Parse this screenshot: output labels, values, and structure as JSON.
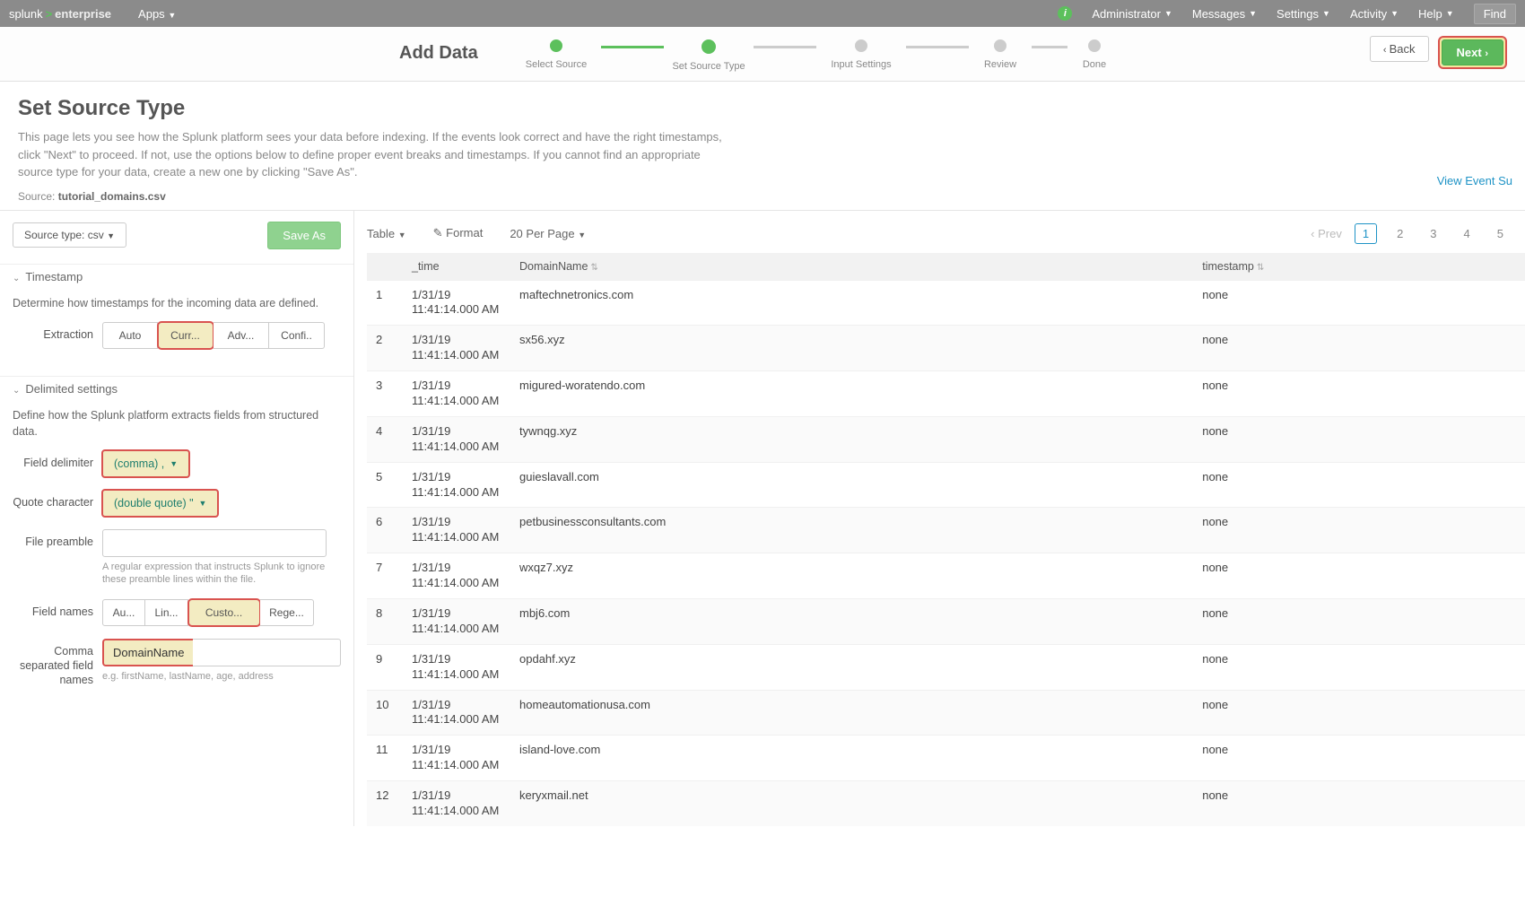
{
  "topbar": {
    "brand_left": "splunk",
    "brand_right": "enterprise",
    "apps": "Apps",
    "menus": [
      "Administrator",
      "Messages",
      "Settings",
      "Activity",
      "Help"
    ],
    "find": "Find"
  },
  "wizard": {
    "title": "Add Data",
    "steps": [
      "Select Source",
      "Set Source Type",
      "Input Settings",
      "Review",
      "Done"
    ],
    "back": "Back",
    "next": "Next"
  },
  "page": {
    "title": "Set Source Type",
    "desc": "This page lets you see how the Splunk platform sees your data before indexing. If the events look correct and have the right timestamps, click \"Next\" to proceed. If not, use the options below to define proper event breaks and timestamps. If you cannot find an appropriate source type for your data, create a new one by clicking \"Save As\".",
    "source_lbl": "Source:",
    "source_val": "tutorial_domains.csv",
    "view_event": "View Event Su"
  },
  "left": {
    "sourcetype": "Source type: csv",
    "saveas": "Save As",
    "ts_header": "Timestamp",
    "ts_desc": "Determine how timestamps for the incoming data are defined.",
    "ts_label": "Extraction",
    "ts_opts": [
      "Auto",
      "Curr...",
      "Adv...",
      "Confi.."
    ],
    "dl_header": "Delimited settings",
    "dl_desc": "Define how the Splunk platform extracts fields from structured data.",
    "fd_label": "Field delimiter",
    "fd_val": "(comma) ,",
    "qc_label": "Quote character",
    "qc_val": "(double quote) \"",
    "fp_label": "File preamble",
    "fp_hint": "A regular expression that instructs Splunk to ignore these preamble lines within the file.",
    "fn_label": "Field names",
    "fn_opts": [
      "Au...",
      "Lin...",
      "Custo...",
      "Rege..."
    ],
    "csfn_label": "Comma separated field names",
    "csfn_val": "DomainName",
    "csfn_hint": "e.g. firstName, lastName, age, address"
  },
  "table": {
    "toolbar": {
      "table": "Table",
      "format": "Format",
      "perpage": "20 Per Page",
      "prev": "Prev"
    },
    "pages": [
      "1",
      "2",
      "3",
      "4",
      "5"
    ],
    "cols": {
      "time": "_time",
      "domain": "DomainName",
      "ts": "timestamp"
    },
    "time_l1": "1/31/19",
    "time_l2": "11:41:14.000 AM",
    "tsval": "none",
    "rows": [
      "maftechnetronics.com",
      "sx56.xyz",
      "migured-woratendo.com",
      "tywnqg.xyz",
      "guieslavall.com",
      "petbusinessconsultants.com",
      "wxqz7.xyz",
      "mbj6.com",
      "opdahf.xyz",
      "homeautomationusa.com",
      "island-love.com",
      "keryxmail.net"
    ]
  }
}
